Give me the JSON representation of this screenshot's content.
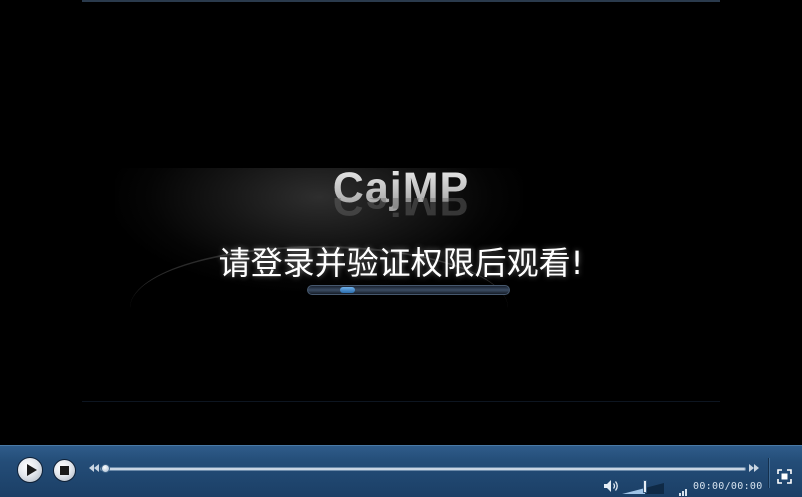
{
  "splash": {
    "logo": "CajMP",
    "message": "请登录并验证权限后观看!",
    "loading_progress": 0.17
  },
  "controls": {
    "play_icon": "play-icon",
    "stop_icon": "stop-icon",
    "rewind_icon": "rewind-icon",
    "forward_icon": "forward-icon",
    "volume_icon": "speaker-icon",
    "volume_level": 0.55,
    "signal_icon": "signal-bars-icon",
    "time_display": "00:00/00:00",
    "fullscreen_icon": "fullscreen-icon",
    "seek_position": 0
  },
  "colors": {
    "control_bar": "#244d78",
    "background": "#000000",
    "message_text": "#ffffff",
    "loading_accent": "#3f87c8"
  }
}
